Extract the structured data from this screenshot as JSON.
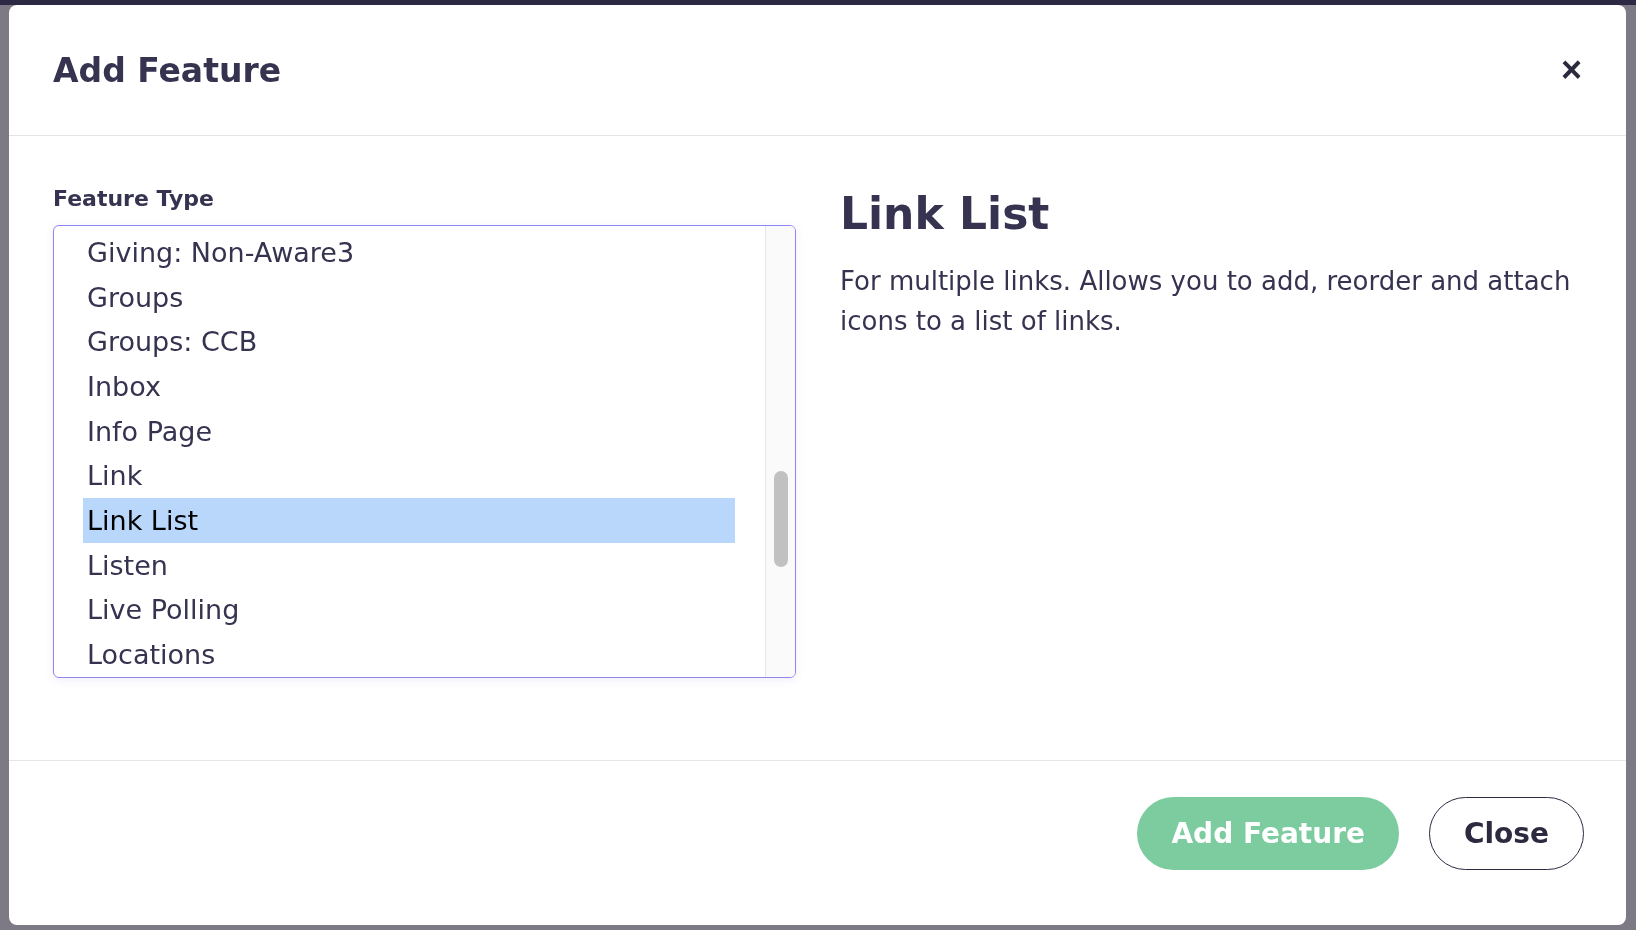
{
  "modal": {
    "title": "Add Feature",
    "close_icon": "×"
  },
  "feature_type": {
    "label": "Feature Type",
    "items": [
      {
        "label": "Giving: Non-Aware3",
        "selected": false
      },
      {
        "label": "Groups",
        "selected": false
      },
      {
        "label": "Groups: CCB",
        "selected": false
      },
      {
        "label": "Inbox",
        "selected": false
      },
      {
        "label": "Info Page",
        "selected": false
      },
      {
        "label": "Link",
        "selected": false
      },
      {
        "label": "Link List",
        "selected": true
      },
      {
        "label": "Listen",
        "selected": false
      },
      {
        "label": "Live Polling",
        "selected": false
      },
      {
        "label": "Locations",
        "selected": false
      }
    ]
  },
  "detail": {
    "title": "Link List",
    "description": "For multiple links. Allows you to add, reorder and attach icons to a list of links."
  },
  "buttons": [
    {
      "label": "Add Feature",
      "kind": "primary"
    },
    {
      "label": "Close",
      "kind": "secondary"
    }
  ]
}
